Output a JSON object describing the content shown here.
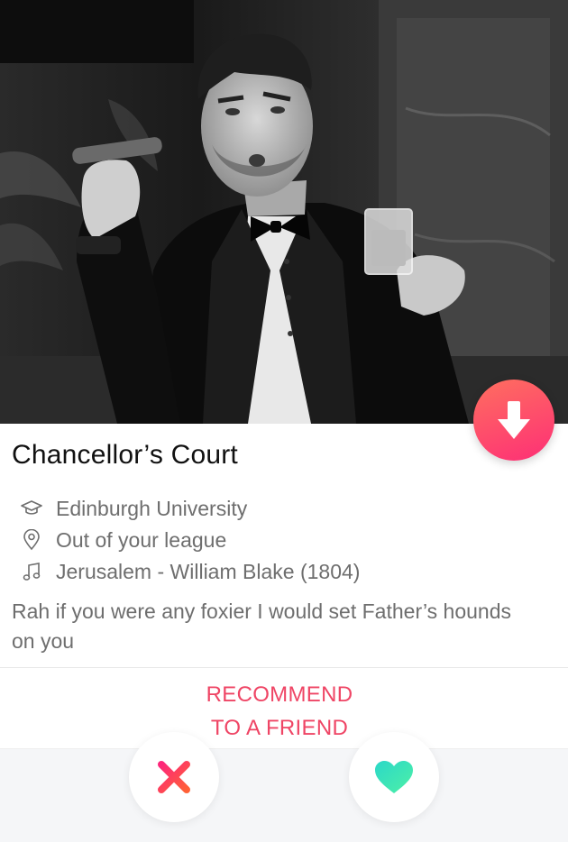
{
  "profile": {
    "name": "Chancellor’s Court",
    "school": "Edinburgh University",
    "location": "Out of your league",
    "anthem": "Jerusalem - William Blake (1804)",
    "bio": "Rah if you were any foxier I would set Father’s hounds on you"
  },
  "actions": {
    "recommend_line1": "RECOMMEND",
    "recommend_line2": "TO A FRIEND"
  },
  "icons": {
    "collapse": "arrow-down-icon",
    "school": "graduation-cap-icon",
    "location": "location-pin-icon",
    "anthem": "music-note-icon",
    "nope": "x-icon",
    "like": "heart-icon"
  },
  "colors": {
    "accent_pink": "#fd2f76",
    "accent_orange": "#ff6f5f",
    "like_green": "#3ee8b5",
    "nope_red": "#fd5068",
    "recommend_text": "#ef4565"
  }
}
